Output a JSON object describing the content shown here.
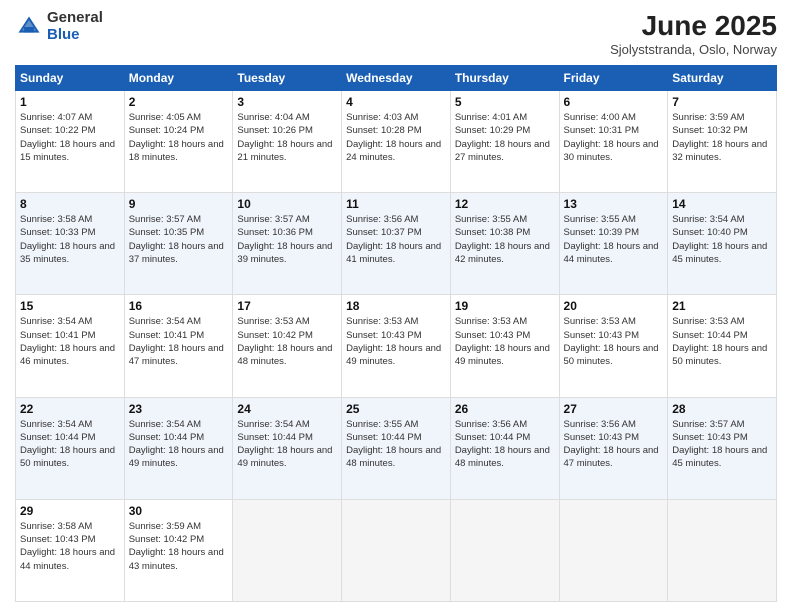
{
  "header": {
    "logo_general": "General",
    "logo_blue": "Blue",
    "title": "June 2025",
    "subtitle": "Sjolyststranda, Oslo, Norway"
  },
  "columns": [
    "Sunday",
    "Monday",
    "Tuesday",
    "Wednesday",
    "Thursday",
    "Friday",
    "Saturday"
  ],
  "weeks": [
    [
      {
        "day": "1",
        "sunrise": "Sunrise: 4:07 AM",
        "sunset": "Sunset: 10:22 PM",
        "daylight": "Daylight: 18 hours and 15 minutes."
      },
      {
        "day": "2",
        "sunrise": "Sunrise: 4:05 AM",
        "sunset": "Sunset: 10:24 PM",
        "daylight": "Daylight: 18 hours and 18 minutes."
      },
      {
        "day": "3",
        "sunrise": "Sunrise: 4:04 AM",
        "sunset": "Sunset: 10:26 PM",
        "daylight": "Daylight: 18 hours and 21 minutes."
      },
      {
        "day": "4",
        "sunrise": "Sunrise: 4:03 AM",
        "sunset": "Sunset: 10:28 PM",
        "daylight": "Daylight: 18 hours and 24 minutes."
      },
      {
        "day": "5",
        "sunrise": "Sunrise: 4:01 AM",
        "sunset": "Sunset: 10:29 PM",
        "daylight": "Daylight: 18 hours and 27 minutes."
      },
      {
        "day": "6",
        "sunrise": "Sunrise: 4:00 AM",
        "sunset": "Sunset: 10:31 PM",
        "daylight": "Daylight: 18 hours and 30 minutes."
      },
      {
        "day": "7",
        "sunrise": "Sunrise: 3:59 AM",
        "sunset": "Sunset: 10:32 PM",
        "daylight": "Daylight: 18 hours and 32 minutes."
      }
    ],
    [
      {
        "day": "8",
        "sunrise": "Sunrise: 3:58 AM",
        "sunset": "Sunset: 10:33 PM",
        "daylight": "Daylight: 18 hours and 35 minutes."
      },
      {
        "day": "9",
        "sunrise": "Sunrise: 3:57 AM",
        "sunset": "Sunset: 10:35 PM",
        "daylight": "Daylight: 18 hours and 37 minutes."
      },
      {
        "day": "10",
        "sunrise": "Sunrise: 3:57 AM",
        "sunset": "Sunset: 10:36 PM",
        "daylight": "Daylight: 18 hours and 39 minutes."
      },
      {
        "day": "11",
        "sunrise": "Sunrise: 3:56 AM",
        "sunset": "Sunset: 10:37 PM",
        "daylight": "Daylight: 18 hours and 41 minutes."
      },
      {
        "day": "12",
        "sunrise": "Sunrise: 3:55 AM",
        "sunset": "Sunset: 10:38 PM",
        "daylight": "Daylight: 18 hours and 42 minutes."
      },
      {
        "day": "13",
        "sunrise": "Sunrise: 3:55 AM",
        "sunset": "Sunset: 10:39 PM",
        "daylight": "Daylight: 18 hours and 44 minutes."
      },
      {
        "day": "14",
        "sunrise": "Sunrise: 3:54 AM",
        "sunset": "Sunset: 10:40 PM",
        "daylight": "Daylight: 18 hours and 45 minutes."
      }
    ],
    [
      {
        "day": "15",
        "sunrise": "Sunrise: 3:54 AM",
        "sunset": "Sunset: 10:41 PM",
        "daylight": "Daylight: 18 hours and 46 minutes."
      },
      {
        "day": "16",
        "sunrise": "Sunrise: 3:54 AM",
        "sunset": "Sunset: 10:41 PM",
        "daylight": "Daylight: 18 hours and 47 minutes."
      },
      {
        "day": "17",
        "sunrise": "Sunrise: 3:53 AM",
        "sunset": "Sunset: 10:42 PM",
        "daylight": "Daylight: 18 hours and 48 minutes."
      },
      {
        "day": "18",
        "sunrise": "Sunrise: 3:53 AM",
        "sunset": "Sunset: 10:43 PM",
        "daylight": "Daylight: 18 hours and 49 minutes."
      },
      {
        "day": "19",
        "sunrise": "Sunrise: 3:53 AM",
        "sunset": "Sunset: 10:43 PM",
        "daylight": "Daylight: 18 hours and 49 minutes."
      },
      {
        "day": "20",
        "sunrise": "Sunrise: 3:53 AM",
        "sunset": "Sunset: 10:43 PM",
        "daylight": "Daylight: 18 hours and 50 minutes."
      },
      {
        "day": "21",
        "sunrise": "Sunrise: 3:53 AM",
        "sunset": "Sunset: 10:44 PM",
        "daylight": "Daylight: 18 hours and 50 minutes."
      }
    ],
    [
      {
        "day": "22",
        "sunrise": "Sunrise: 3:54 AM",
        "sunset": "Sunset: 10:44 PM",
        "daylight": "Daylight: 18 hours and 50 minutes."
      },
      {
        "day": "23",
        "sunrise": "Sunrise: 3:54 AM",
        "sunset": "Sunset: 10:44 PM",
        "daylight": "Daylight: 18 hours and 49 minutes."
      },
      {
        "day": "24",
        "sunrise": "Sunrise: 3:54 AM",
        "sunset": "Sunset: 10:44 PM",
        "daylight": "Daylight: 18 hours and 49 minutes."
      },
      {
        "day": "25",
        "sunrise": "Sunrise: 3:55 AM",
        "sunset": "Sunset: 10:44 PM",
        "daylight": "Daylight: 18 hours and 48 minutes."
      },
      {
        "day": "26",
        "sunrise": "Sunrise: 3:56 AM",
        "sunset": "Sunset: 10:44 PM",
        "daylight": "Daylight: 18 hours and 48 minutes."
      },
      {
        "day": "27",
        "sunrise": "Sunrise: 3:56 AM",
        "sunset": "Sunset: 10:43 PM",
        "daylight": "Daylight: 18 hours and 47 minutes."
      },
      {
        "day": "28",
        "sunrise": "Sunrise: 3:57 AM",
        "sunset": "Sunset: 10:43 PM",
        "daylight": "Daylight: 18 hours and 45 minutes."
      }
    ],
    [
      {
        "day": "29",
        "sunrise": "Sunrise: 3:58 AM",
        "sunset": "Sunset: 10:43 PM",
        "daylight": "Daylight: 18 hours and 44 minutes."
      },
      {
        "day": "30",
        "sunrise": "Sunrise: 3:59 AM",
        "sunset": "Sunset: 10:42 PM",
        "daylight": "Daylight: 18 hours and 43 minutes."
      },
      null,
      null,
      null,
      null,
      null
    ]
  ]
}
